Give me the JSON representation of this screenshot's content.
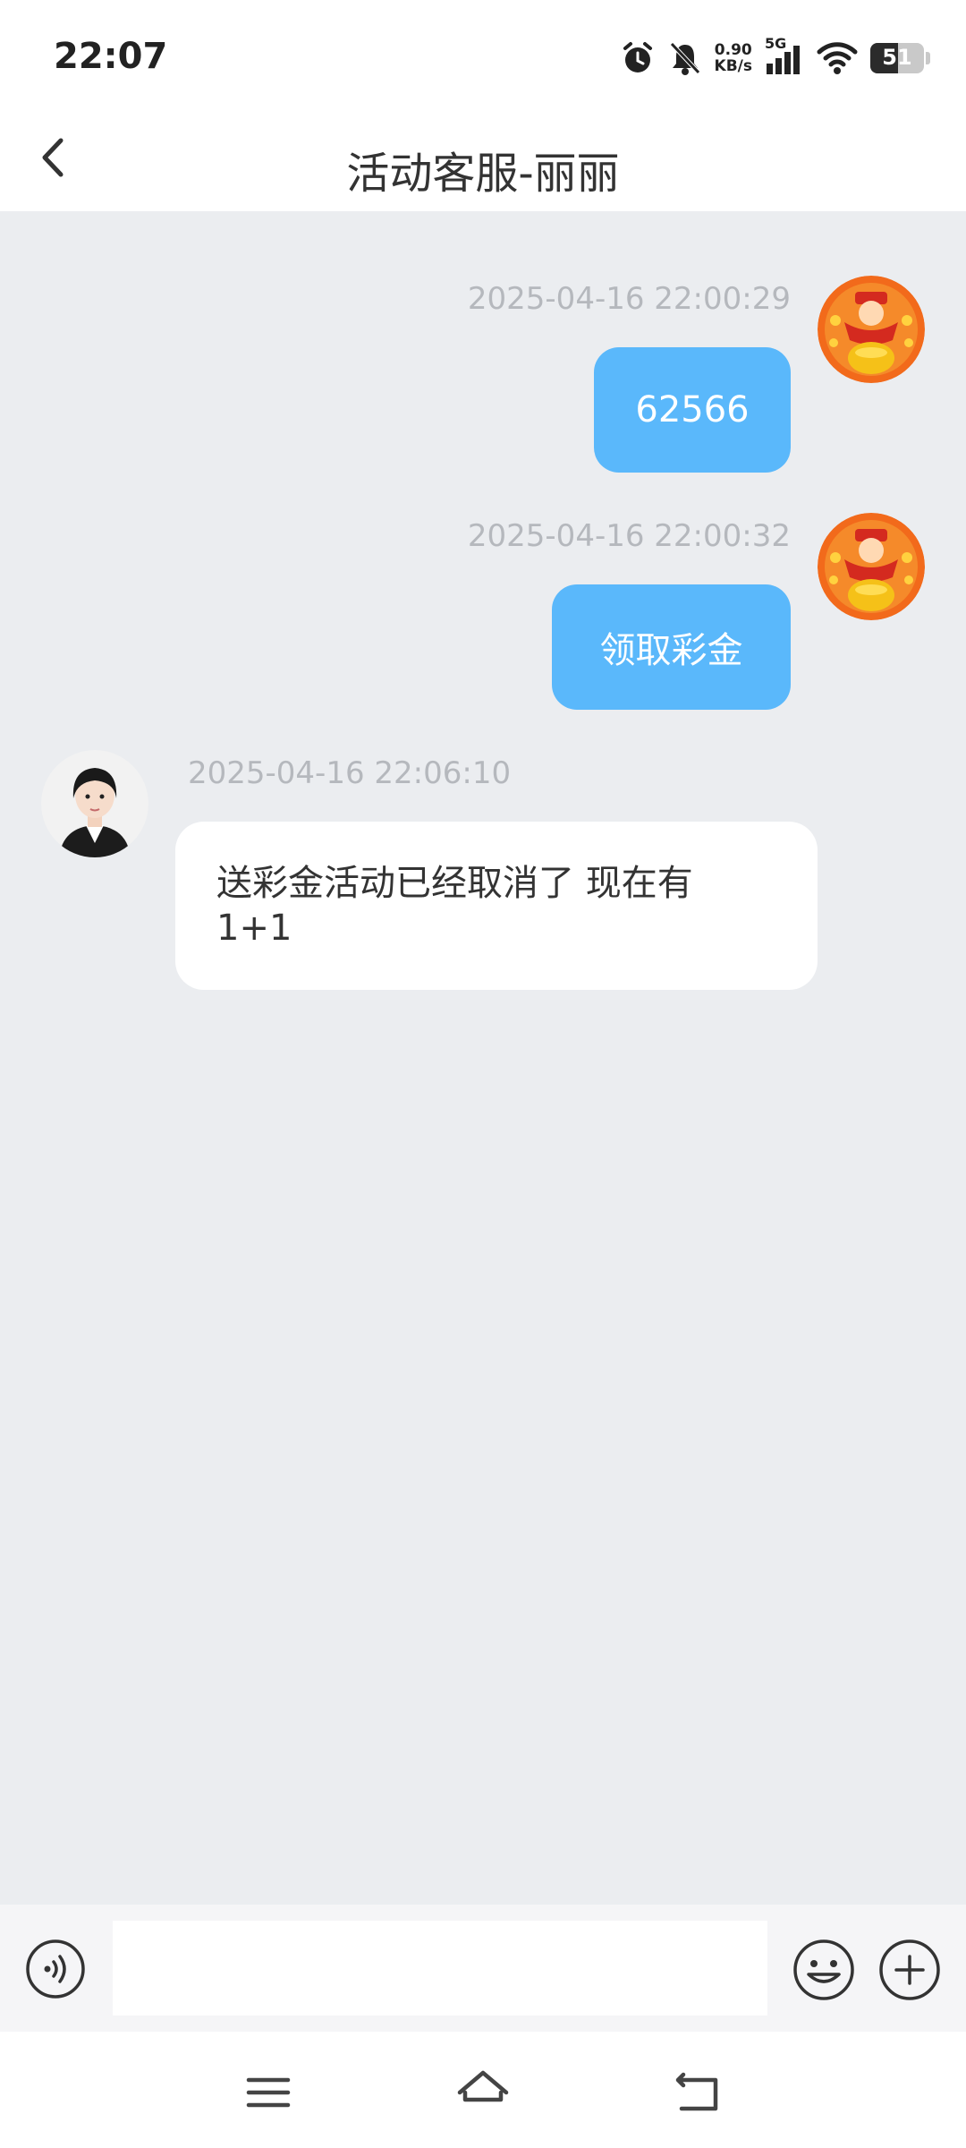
{
  "status_bar": {
    "time": "22:07",
    "net_speed_value": "0.90",
    "net_speed_unit": "KB/s",
    "network_type": "5G",
    "battery_level": "51",
    "icons": [
      "alarm-icon",
      "bell-muted-icon",
      "signal-icon",
      "wifi-icon",
      "battery-icon"
    ]
  },
  "header": {
    "title": "活动客服-丽丽",
    "back_icon": "chevron-left-icon"
  },
  "messages": [
    {
      "from": "me",
      "timestamp": "2025-04-16 22:00:29",
      "text": "62566"
    },
    {
      "from": "me",
      "timestamp": "2025-04-16 22:00:32",
      "text": "领取彩金"
    },
    {
      "from": "agent",
      "timestamp": "2025-04-16 22:06:10",
      "text_line1": "送彩金活动已经取消了 现在有",
      "text_line2": "1+1"
    }
  ],
  "input_bar": {
    "placeholder": "",
    "value": "",
    "icons": [
      "voice-icon",
      "emoji-icon",
      "plus-icon"
    ]
  },
  "nav_bar": {
    "icons": [
      "menu-icon",
      "home-icon",
      "back-nav-icon"
    ]
  },
  "colors": {
    "my_bubble": "#5ab8fb",
    "background": "#ebedf0",
    "timestamp": "#b5b8bd"
  }
}
